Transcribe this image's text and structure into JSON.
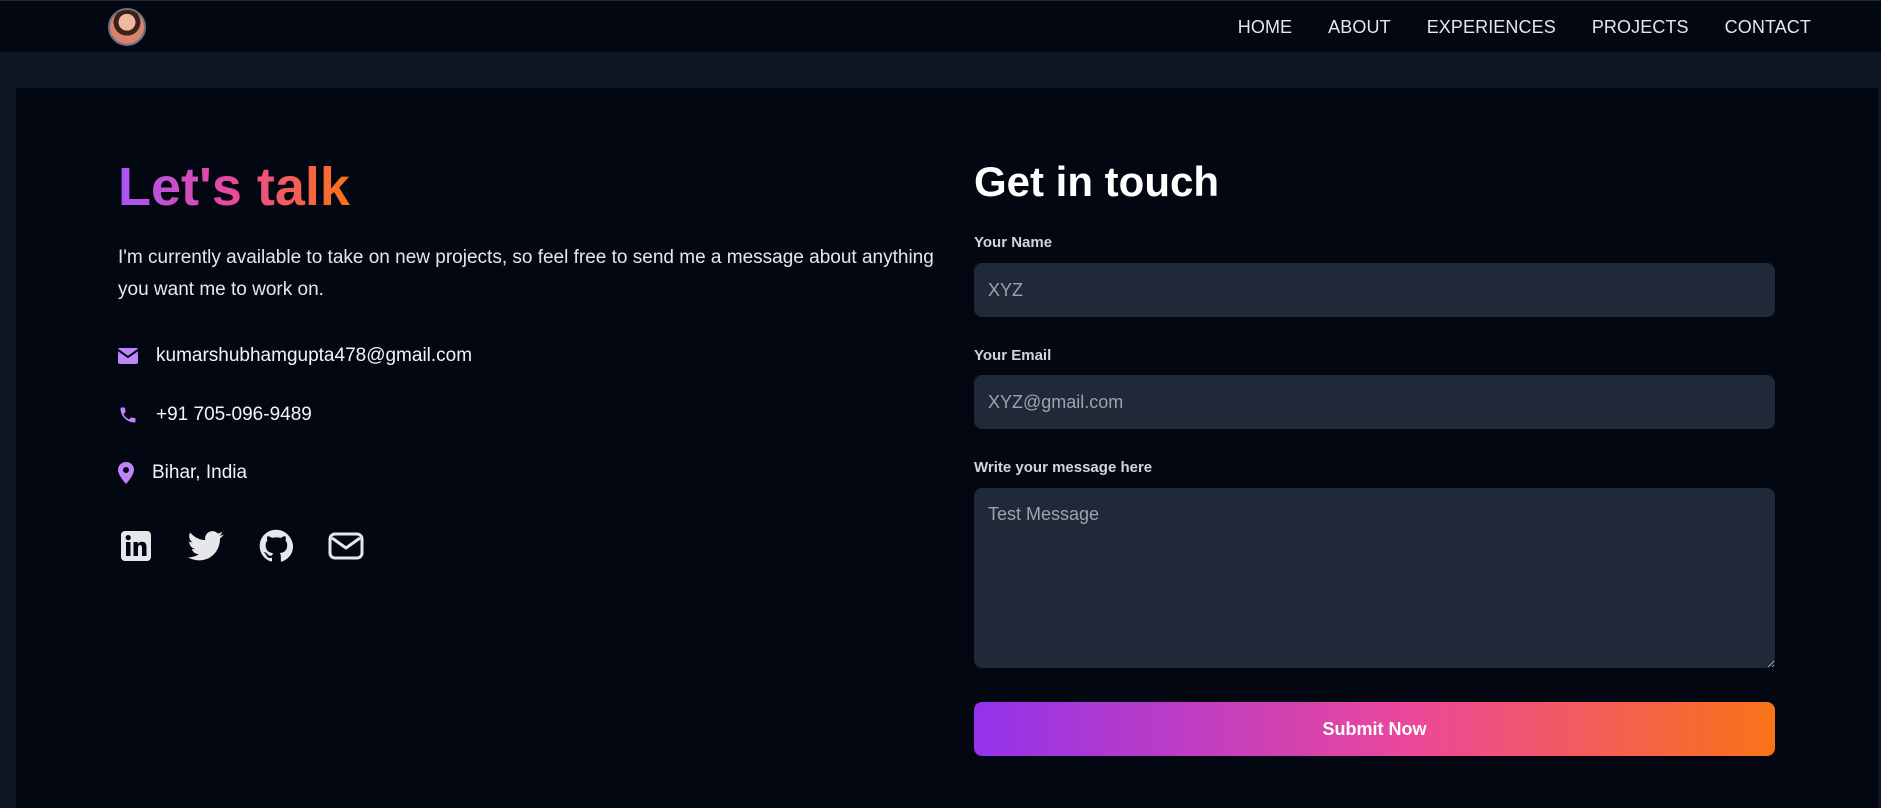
{
  "nav": {
    "links": [
      "HOME",
      "ABOUT",
      "EXPERIENCES",
      "PROJECTS",
      "CONTACT"
    ]
  },
  "contact": {
    "title": "Let's talk",
    "intro": "I'm currently available to take on new projects, so feel free to send me a message about anything you want me to work on.",
    "email": "kumarshubhamgupta478@gmail.com",
    "phone": "+91 705-096-9489",
    "location": "Bihar, India",
    "socials": [
      "linkedin-icon",
      "twitter-icon",
      "github-icon",
      "mail-icon"
    ]
  },
  "form": {
    "title": "Get in touch",
    "name_label": "Your Name",
    "name_placeholder": "XYZ",
    "email_label": "Your Email",
    "email_placeholder": "XYZ@gmail.com",
    "message_label": "Write your message here",
    "message_placeholder": "Test Message",
    "submit_label": "Submit Now"
  },
  "colors": {
    "accent_purple": "#a855f7",
    "accent_pink": "#ec4899",
    "accent_orange": "#f97316",
    "background": "#030712",
    "input_bg": "#1f2937"
  }
}
